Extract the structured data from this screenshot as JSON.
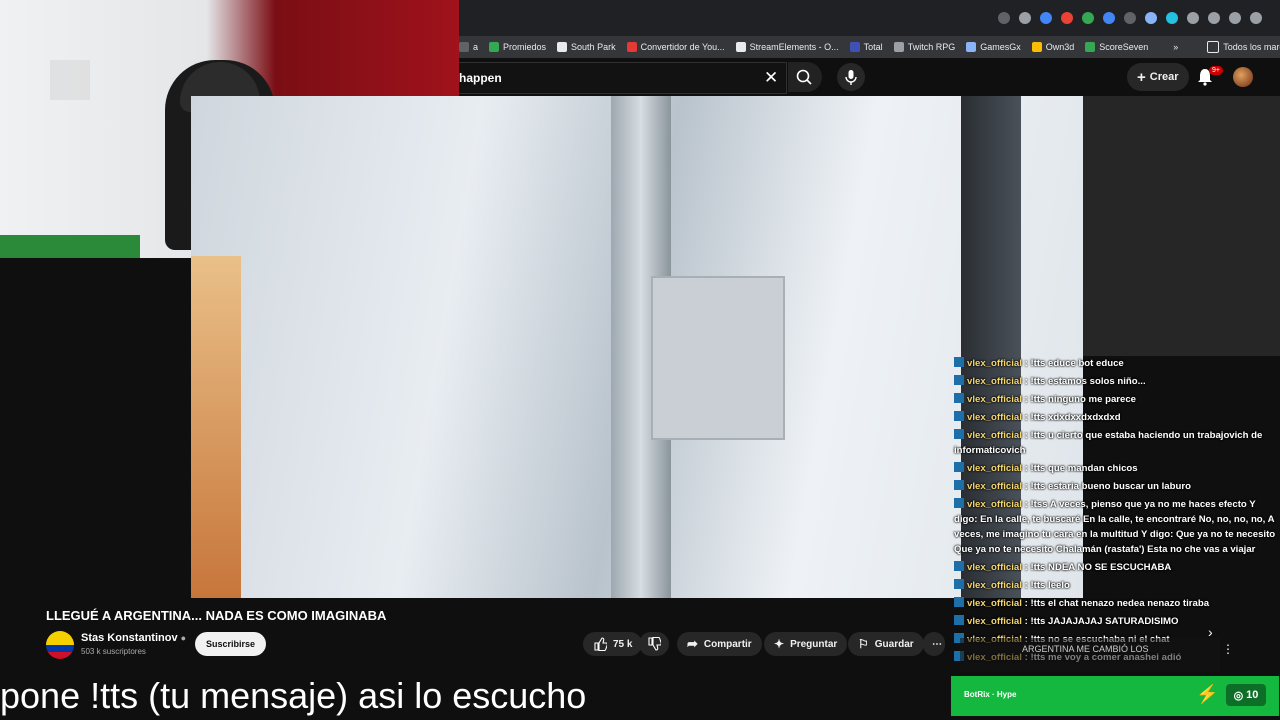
{
  "browser": {
    "bookmarks": [
      {
        "label": "a",
        "color": "#5f6368"
      },
      {
        "label": "Promiedos",
        "color": "#34a853"
      },
      {
        "label": "South Park",
        "color": "#e8eaed"
      },
      {
        "label": "Convertidor de You...",
        "color": "#e53935"
      },
      {
        "label": "StreamElements - O...",
        "color": "#e8eaed"
      },
      {
        "label": "Total",
        "color": "#3f51b5"
      },
      {
        "label": "Twitch RPG",
        "color": "#9aa0a6"
      },
      {
        "label": "GamesGx",
        "color": "#8ab4f8"
      },
      {
        "label": "Own3d",
        "color": "#fbbc04"
      },
      {
        "label": "ScoreSeven",
        "color": "#34a853"
      }
    ],
    "all_bookmarks_label": "Todos los marcadores"
  },
  "header": {
    "search_value": "happen",
    "create_label": "Crear",
    "notifications_badge": "9+"
  },
  "video": {
    "title": "LLEGUÉ A ARGENTINA... NADA ES COMO IMAGINABA",
    "channel_name": "Stas Konstantinov",
    "subscribers": "503 k suscriptores",
    "subscribe_label": "Suscribirse",
    "likes": "75 k",
    "share_label": "Compartir",
    "ask_label": "Preguntar",
    "save_label": "Guardar"
  },
  "chat": {
    "messages": [
      {
        "user": "vlex_official",
        "text": "!tts educe bot educe"
      },
      {
        "user": "vlex_official",
        "text": "!tts estamos solos niño..."
      },
      {
        "user": "vlex_official",
        "text": "!tts ninguno me parece"
      },
      {
        "user": "vlex_official",
        "text": "!tts xdxdxxdxdxdxd"
      },
      {
        "user": "vlex_official",
        "text": "!tts u cierto que estaba haciendo un trabajovich de informaticovich"
      },
      {
        "user": "vlex_official",
        "text": "!tts que mandan chicos"
      },
      {
        "user": "vlex_official",
        "text": "!tts estaria bueno buscar un laburo"
      },
      {
        "user": "vlex_official",
        "text": "!tss A veces, pienso que ya no me haces efecto Y digo: En la calle, te buscaré En la calle, te encontraré No, no, no, no, A veces, me imagino tu cara en la multitud Y digo: Que ya no te necesito Que ya no te necesito Chalamán (rastafa') Esta no che vas a viajar"
      },
      {
        "user": "vlex_official",
        "text": "!tts NDEA NO SE ESCUCHABA"
      },
      {
        "user": "vlex_official",
        "text": "!tts leelo"
      },
      {
        "user": "vlex_official",
        "text": "!tts el chat nenazo nedea nenazo tiraba"
      },
      {
        "user": "vlex_official",
        "text": "!tts JAJAJAJAJ SATURADISIMO"
      },
      {
        "user": "vlex_official",
        "text": "!tts no se escuchaba ni el chat"
      },
      {
        "user": "vlex_official",
        "text": "!tts me voy a comer anashei adió"
      }
    ],
    "promo_text": "ARGENTINA ME CAMBIÓ LOS"
  },
  "overlay": {
    "subtitle": "pone !tts (tu mensaje) asi lo escucho",
    "botrix_label": "BotRix · Hype",
    "points": "10"
  }
}
